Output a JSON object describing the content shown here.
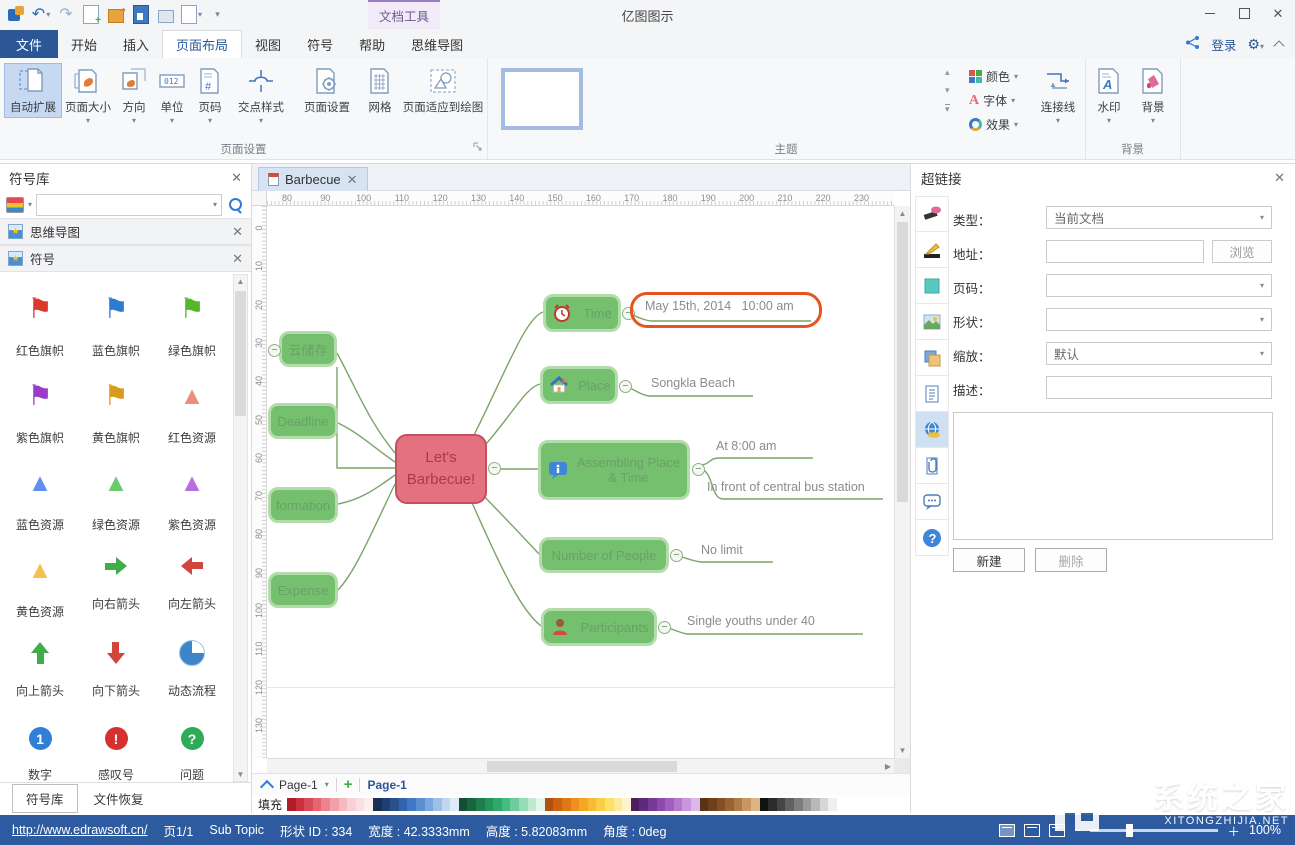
{
  "window": {
    "title": "亿图图示",
    "doc_tools": "文档工具"
  },
  "quick_access": {
    "icons": [
      "edraw-logo",
      "undo",
      "redo",
      "import",
      "open",
      "save",
      "print",
      "print-preview",
      "customize-toolbar"
    ]
  },
  "tabs": {
    "file": "文件",
    "items": [
      "开始",
      "插入",
      "页面布局",
      "视图",
      "符号",
      "帮助",
      "思维导图"
    ],
    "active": "页面布局"
  },
  "account": {
    "login": "登录"
  },
  "ribbon": {
    "page_setup": {
      "label": "页面设置",
      "auto_expand": "自动扩展",
      "page_size": "页面大小",
      "orientation": "方向",
      "unit": "单位",
      "page_number": "页码",
      "junction_style": "交点样式",
      "page_dialog": "页面设置",
      "grid": "网格",
      "fit_to_drawing": "页面适应到绘图"
    },
    "theme": {
      "label": "主题",
      "color": "颜色",
      "font": "字体",
      "effect": "效果",
      "connector": "连接线"
    },
    "background": {
      "label": "背景",
      "watermark": "水印",
      "background": "背景"
    }
  },
  "left_panel": {
    "title": "符号库",
    "section_mindmap": "思维导图",
    "section_symbols": "符号",
    "symbols": [
      {
        "label": "红色旗帜",
        "icon": "flag",
        "glyph": "⚑",
        "color": "#d93a2b"
      },
      {
        "label": "蓝色旗帜",
        "icon": "flag",
        "glyph": "⚑",
        "color": "#2b7cd3"
      },
      {
        "label": "绿色旗帜",
        "icon": "flag",
        "glyph": "⚑",
        "color": "#57b52a"
      },
      {
        "label": "紫色旗帜",
        "icon": "flag",
        "glyph": "⚑",
        "color": "#9a3bc9"
      },
      {
        "label": "黄色旗帜",
        "icon": "flag",
        "glyph": "⚑",
        "color": "#d99b1e"
      },
      {
        "label": "红色资源",
        "icon": "cone",
        "glyph": "▲",
        "color": "#ef8d7c"
      },
      {
        "label": "蓝色资源",
        "icon": "cone",
        "glyph": "▲",
        "color": "#5f8ff0"
      },
      {
        "label": "绿色资源",
        "icon": "cone",
        "glyph": "▲",
        "color": "#6cc96c"
      },
      {
        "label": "紫色资源",
        "icon": "cone",
        "glyph": "▲",
        "color": "#b86ede"
      },
      {
        "label": "黄色资源",
        "icon": "cone",
        "glyph": "▲",
        "color": "#f2c14e"
      },
      {
        "label": "向右箭头",
        "icon": "arrow",
        "dir": "right",
        "color": "#3fae49"
      },
      {
        "label": "向左箭头",
        "icon": "arrow",
        "dir": "left",
        "color": "#d0453c"
      },
      {
        "label": "向上箭头",
        "icon": "arrow",
        "dir": "up",
        "color": "#3fae49"
      },
      {
        "label": "向下箭头",
        "icon": "arrow",
        "dir": "down",
        "color": "#d0453c"
      },
      {
        "label": "动态流程",
        "icon": "pie"
      },
      {
        "label": "数字",
        "icon": "badge",
        "glyph": "1",
        "color": "#2f7fd6"
      },
      {
        "label": "感叹号",
        "icon": "badge",
        "glyph": "!",
        "color": "#d63031"
      },
      {
        "label": "问题",
        "icon": "badge",
        "glyph": "?",
        "color": "#2eab57"
      }
    ],
    "footer_tabs": [
      "符号库",
      "文件恢复"
    ]
  },
  "canvas": {
    "doc_tab": "Barbecue",
    "h_ruler": [
      80,
      90,
      100,
      110,
      120,
      130,
      140,
      150,
      160,
      170,
      180,
      190,
      200,
      210,
      220,
      230
    ],
    "v_ruler": [
      0,
      10,
      20,
      30,
      40,
      50,
      60,
      70,
      80,
      90,
      100,
      110,
      120,
      130
    ],
    "page_dropdown": "Page-1",
    "page_tab": "Page-1",
    "fill_label": "填充",
    "palette": [
      "#b01d28",
      "#c9303c",
      "#d84a57",
      "#e26571",
      "#ea838d",
      "#f0a0a8",
      "#f5bac0",
      "#f9d0d4",
      "#fbe0e3",
      "#fdedee",
      "#1b2f54",
      "#1f3f73",
      "#28508f",
      "#3263ad",
      "#3f78c4",
      "#5b8fd2",
      "#7ba7de",
      "#9dbfe9",
      "#c0d6f1",
      "#ddeaf8",
      "#134f33",
      "#17663f",
      "#1d7d4c",
      "#259458",
      "#2fa96a",
      "#45bc80",
      "#6ccc9a",
      "#95dcb6",
      "#bfead1",
      "#e2f5ea",
      "#b4500e",
      "#cc6212",
      "#e07817",
      "#ee8f1f",
      "#f5a623",
      "#f8bb31",
      "#fbcf45",
      "#fde06a",
      "#fee99b",
      "#fef3cd",
      "#4b1e63",
      "#5f2a7c",
      "#763995",
      "#8d4aae",
      "#a25dc0",
      "#b678cf",
      "#c997dd",
      "#dcb8ea",
      "#5a3214",
      "#6e401c",
      "#835026",
      "#996231",
      "#b07a44",
      "#c79661",
      "#dcb583",
      "#111111",
      "#2b2b2b",
      "#454545",
      "#616161",
      "#7d7d7d",
      "#9a9a9a",
      "#b8b8b8",
      "#d6d6d6",
      "#efefef"
    ]
  },
  "mindmap": {
    "center": "Let's Barbecue!",
    "left_topics": [
      "云储存",
      "Deadline",
      "formation",
      "Expense"
    ],
    "right_topics": [
      {
        "label": "Time",
        "note": "May 15th, 2014   10:00 am",
        "highlighted": true
      },
      {
        "label": "Place",
        "note": "Songkla Beach"
      },
      {
        "label": "Assembling Place & Time",
        "notes": [
          "At 8:00 am",
          "In front of central bus station"
        ]
      },
      {
        "label": "Number of People",
        "note": "No limit"
      },
      {
        "label": "Participants",
        "note": "Single youths under 40"
      }
    ]
  },
  "hyperlink_panel": {
    "title": "超链接",
    "side_icons": [
      "format",
      "pencil",
      "color",
      "picture",
      "layers",
      "note",
      "hyperlink",
      "attachment",
      "comment",
      "help"
    ],
    "type_label": "类型：",
    "type_value": "当前文档",
    "address_label": "地址：",
    "browse": "浏览",
    "page_label": "页码：",
    "shape_label": "形状：",
    "zoom_label": "缩放：",
    "zoom_value": "默认",
    "desc_label": "描述：",
    "new_btn": "新建",
    "delete_btn": "删除"
  },
  "status_bar": {
    "link": "http://www.edrawsoft.cn/",
    "page": "页1/1",
    "selection": "Sub Topic",
    "shape_id": "形状 ID : 334",
    "width": "宽度 : 42.3333mm",
    "height": "高度 : 5.82083mm",
    "angle": "角度 : 0deg",
    "zoom": "100%"
  },
  "watermark": {
    "cn": "系统之家",
    "en": "XITONGZHIJIA.NET"
  },
  "colors": {
    "accent": "#2b5797",
    "status_bar": "#2e5b9f",
    "topic_green": "#74c06f",
    "topic_border": "#b2dcaa",
    "center_red": "#e4727e",
    "highlight_orange": "#e8541d",
    "link_green": "#7ba466"
  }
}
